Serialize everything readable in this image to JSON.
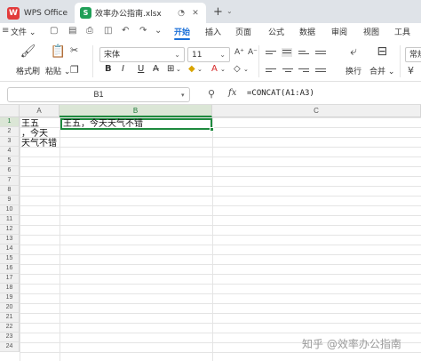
{
  "tabs": {
    "app_label": "WPS Office",
    "doc_label": "效率办公指南.xlsx",
    "app_logo_letter": "W",
    "doc_logo_letter": "S"
  },
  "menu": {
    "file_label": "文件",
    "tabs": [
      "开始",
      "插入",
      "页面",
      "公式",
      "数据",
      "审阅",
      "视图",
      "工具"
    ],
    "active_tab": "开始"
  },
  "ribbon": {
    "format_painter": "格式刷",
    "paste": "粘贴",
    "font_name": "宋体",
    "font_size": "11",
    "wrap": "换行",
    "merge": "合并",
    "number_format": "常规",
    "bold": "B",
    "italic": "I",
    "underline": "U",
    "font_color_glyph": "A"
  },
  "formula_bar": {
    "name_box": "B1",
    "fx": "fx",
    "formula": "=CONCAT(A1:A3)"
  },
  "columns": [
    "A",
    "B",
    "C"
  ],
  "rows": [
    "1",
    "2",
    "3",
    "4",
    "5",
    "6",
    "7",
    "8",
    "9",
    "10",
    "11",
    "12",
    "13",
    "14",
    "15",
    "16",
    "17",
    "18",
    "19",
    "20",
    "21",
    "22",
    "23",
    "24"
  ],
  "cells": {
    "A_lines": "王五\n，今天\n天气不错",
    "B1": "王五，今天天气不错"
  },
  "watermark": "知乎 @效率办公指南",
  "colors": {
    "accent": "#1a6fd8",
    "selection": "#1e8a3e",
    "wps_red": "#e23b3b",
    "sheet_green": "#1f9f57"
  }
}
